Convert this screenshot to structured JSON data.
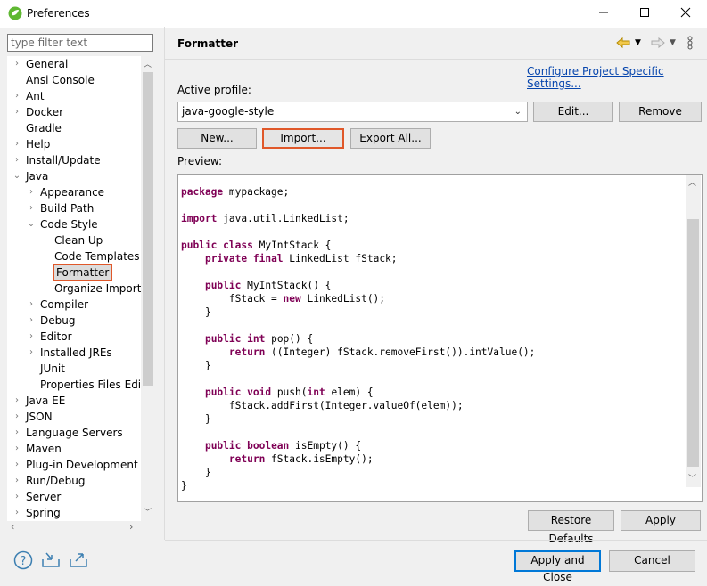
{
  "window": {
    "title": "Preferences",
    "minimize_icon": "minimize-icon",
    "maximize_icon": "maximize-icon",
    "close_icon": "close-icon"
  },
  "filter": {
    "placeholder": "type filter text",
    "value": ""
  },
  "tree": [
    {
      "label": "General",
      "arrow": "›"
    },
    {
      "label": "Ansi Console",
      "arrow": ""
    },
    {
      "label": "Ant",
      "arrow": "›"
    },
    {
      "label": "Docker",
      "arrow": "›"
    },
    {
      "label": "Gradle",
      "arrow": ""
    },
    {
      "label": "Help",
      "arrow": "›"
    },
    {
      "label": "Install/Update",
      "arrow": "›"
    },
    {
      "label": "Java",
      "arrow": "⌄"
    },
    {
      "label": "Appearance",
      "arrow": "›"
    },
    {
      "label": "Build Path",
      "arrow": "›"
    },
    {
      "label": "Code Style",
      "arrow": "⌄"
    },
    {
      "label": "Clean Up",
      "arrow": ""
    },
    {
      "label": "Code Templates",
      "arrow": ""
    },
    {
      "label": "Formatter",
      "arrow": "",
      "selected": true
    },
    {
      "label": "Organize Imports",
      "arrow": ""
    },
    {
      "label": "Compiler",
      "arrow": "›"
    },
    {
      "label": "Debug",
      "arrow": "›"
    },
    {
      "label": "Editor",
      "arrow": "›"
    },
    {
      "label": "Installed JREs",
      "arrow": "›"
    },
    {
      "label": "JUnit",
      "arrow": ""
    },
    {
      "label": "Properties Files Edito",
      "arrow": ""
    },
    {
      "label": "Java EE",
      "arrow": "›"
    },
    {
      "label": "JSON",
      "arrow": "›"
    },
    {
      "label": "Language Servers",
      "arrow": "›"
    },
    {
      "label": "Maven",
      "arrow": "›"
    },
    {
      "label": "Plug-in Development",
      "arrow": "›"
    },
    {
      "label": "Run/Debug",
      "arrow": "›"
    },
    {
      "label": "Server",
      "arrow": "›"
    },
    {
      "label": "Spring",
      "arrow": "›"
    }
  ],
  "page": {
    "title": "Formatter",
    "back_icon": "back-arrow-icon",
    "forward_icon": "forward-arrow-icon",
    "menu_icon": "view-menu-icon",
    "configure_link": "Configure Project Specific Settings...",
    "active_profile_label": "Active profile:",
    "profile_value": "java-google-style",
    "buttons": {
      "edit": "Edit...",
      "remove": "Remove",
      "new": "New...",
      "import": "Import...",
      "export_all": "Export All..."
    },
    "preview_label": "Preview:",
    "preview_code": [
      [
        {
          "k": 1,
          "t": "package"
        },
        {
          "t": " mypackage;"
        }
      ],
      [],
      [
        {
          "k": 1,
          "t": "import"
        },
        {
          "t": " java.util.LinkedList;"
        }
      ],
      [],
      [
        {
          "k": 1,
          "t": "public"
        },
        {
          "t": " "
        },
        {
          "k": 1,
          "t": "class"
        },
        {
          "t": " MyIntStack {"
        }
      ],
      [
        {
          "t": "    "
        },
        {
          "k": 1,
          "t": "private"
        },
        {
          "t": " "
        },
        {
          "k": 1,
          "t": "final"
        },
        {
          "t": " LinkedList fStack;"
        }
      ],
      [],
      [
        {
          "t": "    "
        },
        {
          "k": 1,
          "t": "public"
        },
        {
          "t": " MyIntStack() {"
        }
      ],
      [
        {
          "t": "        fStack = "
        },
        {
          "k": 1,
          "t": "new"
        },
        {
          "t": " LinkedList();"
        }
      ],
      [
        {
          "t": "    }"
        }
      ],
      [],
      [
        {
          "t": "    "
        },
        {
          "k": 1,
          "t": "public"
        },
        {
          "t": " "
        },
        {
          "k": 1,
          "t": "int"
        },
        {
          "t": " pop() {"
        }
      ],
      [
        {
          "t": "        "
        },
        {
          "k": 1,
          "t": "return"
        },
        {
          "t": " ((Integer) fStack.removeFirst()).intValue();"
        }
      ],
      [
        {
          "t": "    }"
        }
      ],
      [],
      [
        {
          "t": "    "
        },
        {
          "k": 1,
          "t": "public"
        },
        {
          "t": " "
        },
        {
          "k": 1,
          "t": "void"
        },
        {
          "t": " push("
        },
        {
          "k": 1,
          "t": "int"
        },
        {
          "t": " elem) {"
        }
      ],
      [
        {
          "t": "        fStack.addFirst(Integer.valueOf(elem));"
        }
      ],
      [
        {
          "t": "    }"
        }
      ],
      [],
      [
        {
          "t": "    "
        },
        {
          "k": 1,
          "t": "public"
        },
        {
          "t": " "
        },
        {
          "k": 1,
          "t": "boolean"
        },
        {
          "t": " isEmpty() {"
        }
      ],
      [
        {
          "t": "        "
        },
        {
          "k": 1,
          "t": "return"
        },
        {
          "t": " fStack.isEmpty();"
        }
      ],
      [
        {
          "t": "    }"
        }
      ],
      [
        {
          "t": "}"
        }
      ]
    ],
    "restore_defaults": "Restore Defaults",
    "apply": "Apply"
  },
  "footer": {
    "help_icon": "help-icon",
    "import_icon": "import-preferences-icon",
    "export_icon": "export-preferences-icon",
    "apply_and_close": "Apply and Close",
    "cancel": "Cancel"
  },
  "colors": {
    "keyword": "#7f0055",
    "link": "#0645ad",
    "highlight": "#e0582a"
  }
}
